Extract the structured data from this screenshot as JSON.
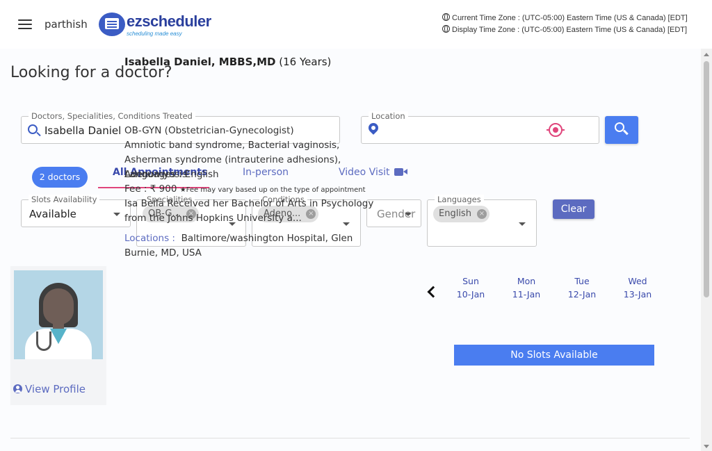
{
  "header": {
    "username": "parthish",
    "logo_text": "ezscheduler",
    "logo_tagline": "scheduling made easy",
    "current_timezone": "Current Time Zone : (UTC-05:00) Eastern Time (US & Canada) [EDT]",
    "display_timezone": "Display Time Zone : (UTC-05:00) Eastern Time (US & Canada) [EDT]"
  },
  "page": {
    "title": "Looking for a doctor?"
  },
  "search": {
    "query_label": "Doctors, Specialities, Conditions Treated",
    "query_value": "Isabella Daniel",
    "location_label": "Location",
    "location_value": ""
  },
  "results": {
    "count_label": "2 doctors"
  },
  "tabs": [
    {
      "label": "All Appointments",
      "active": true
    },
    {
      "label": "In-person",
      "active": false
    },
    {
      "label": "Video Visit",
      "active": false
    }
  ],
  "filters": {
    "slots": {
      "label": "Slots Availability",
      "value": "Available"
    },
    "specialities": {
      "label": "Specialities",
      "chip": "OB-G..."
    },
    "conditions": {
      "label": "Conditions",
      "chip": "Adeno..."
    },
    "gender": {
      "placeholder": "Gender"
    },
    "languages": {
      "label": "Languages",
      "chip": "English"
    },
    "clear_label": "Clear"
  },
  "doctor": {
    "name": "Isabella Daniel, MBBS,MD",
    "experience": "(16 Years)",
    "speciality": "OB-GYN (Obstetrician-Gynecologist)",
    "conditions": "Amniotic band syndrome, Bacterial vaginosis, Asherman syndrome (intrauterine adhesions), Adenomyosis",
    "languages": "Languages : English",
    "fee": "Fee : ₹ 900",
    "fee_note": "★Fee may vary based up on the type of appointment",
    "bio": "Isa Bella Received her Bachelor of Arts in Psychology from the Johns Hopkins University a...",
    "locations_label": "Locations :",
    "locations": "Baltimore/washington Hospital, Glen Burnie, MD, USA",
    "view_profile": "View Profile"
  },
  "calendar": {
    "days": [
      {
        "dow": "Sun",
        "date": "10-Jan"
      },
      {
        "dow": "Mon",
        "date": "11-Jan"
      },
      {
        "dow": "Tue",
        "date": "12-Jan"
      },
      {
        "dow": "Wed",
        "date": "13-Jan"
      }
    ],
    "no_slots": "No Slots Available"
  },
  "colors": {
    "primary": "#4a7df0",
    "accent": "#e0457b",
    "indigo": "#5c6bc0"
  }
}
